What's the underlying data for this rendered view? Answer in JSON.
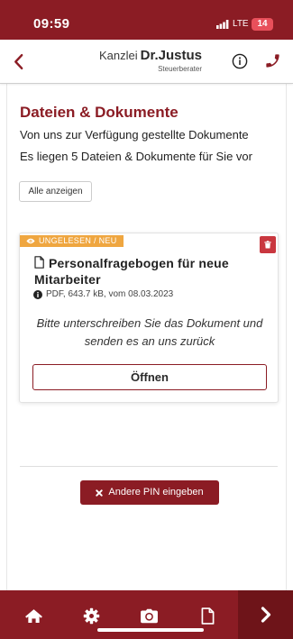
{
  "status_bar": {
    "time": "09:59",
    "network": "LTE",
    "battery": "14",
    "signal_icon": "cellular-signal-icon"
  },
  "header": {
    "back_icon": "chevron-left-icon",
    "brand_prefix": "Kanzlei",
    "brand_name": "Dr.Justus",
    "brand_subtitle": "Steuerberater",
    "info_icon": "info-circle-icon",
    "phone_icon": "phone-icon"
  },
  "section": {
    "title": "Dateien & Dokumente",
    "description": "Von uns zur Verfügung gestellte Dokumente",
    "count_text": "Es liegen 5 Dateien & Dokumente für Sie vor",
    "show_all_label": "Alle anzeigen"
  },
  "documents": [
    {
      "badge": "UNGELESEN / NEU",
      "badge_icon": "eye-icon",
      "delete_icon": "trash-icon",
      "file_icon": "document-outline-icon",
      "title": "Personalfragebogen für neue Mitarbeiter",
      "meta_icon": "info-filled-icon",
      "meta": "PDF, 643.7 kB, vom 08.03.2023",
      "instruction": "Bitte unterschreiben Sie das Dokument und senden es an uns zurück",
      "open_label": "Öffnen"
    }
  ],
  "pin_button": {
    "icon": "close-icon",
    "label": "Andere PIN eingeben"
  },
  "bottom_nav": {
    "items": [
      {
        "icon": "home-icon"
      },
      {
        "icon": "gear-icon"
      },
      {
        "icon": "camera-icon"
      },
      {
        "icon": "document-icon"
      }
    ],
    "next_icon": "chevron-right-icon"
  },
  "colors": {
    "primary": "#8b1c24",
    "primary_dark": "#6e1419",
    "badge": "#efa640",
    "delete": "#c9373f",
    "battery": "#e8505b"
  }
}
